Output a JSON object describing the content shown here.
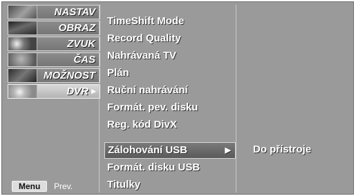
{
  "categories": [
    {
      "label": "NASTAV",
      "icon": "setup-icon",
      "selected": false
    },
    {
      "label": "OBRAZ",
      "icon": "picture-icon",
      "selected": false
    },
    {
      "label": "ZVUK",
      "icon": "audio-icon",
      "selected": false
    },
    {
      "label": "ČAS",
      "icon": "time-icon",
      "selected": false
    },
    {
      "label": "MOŽNOST",
      "icon": "option-icon",
      "selected": false
    },
    {
      "label": "DVR",
      "icon": "dvr-icon",
      "selected": true
    }
  ],
  "menu_items": [
    {
      "label": "TimeShift Mode"
    },
    {
      "label": "Record Quality"
    },
    {
      "label": "Nahrávaná TV"
    },
    {
      "label": "Plán"
    },
    {
      "label": "Ruční nahrávání"
    },
    {
      "label": "Formát. pev. disku"
    },
    {
      "label": "Reg. kód DivX"
    },
    {
      "label": "Zálohování USB",
      "selected": true
    },
    {
      "label": "Formát. disku USB"
    },
    {
      "label": "Titulky"
    }
  ],
  "submenu": {
    "label": "Do přístroje"
  },
  "footer": {
    "menu_key": "Menu",
    "prev_label": "Prev."
  },
  "colors": {
    "panel": "#9a9a9a",
    "selected_category": "#c6c6c6",
    "text": "#ffffff"
  }
}
